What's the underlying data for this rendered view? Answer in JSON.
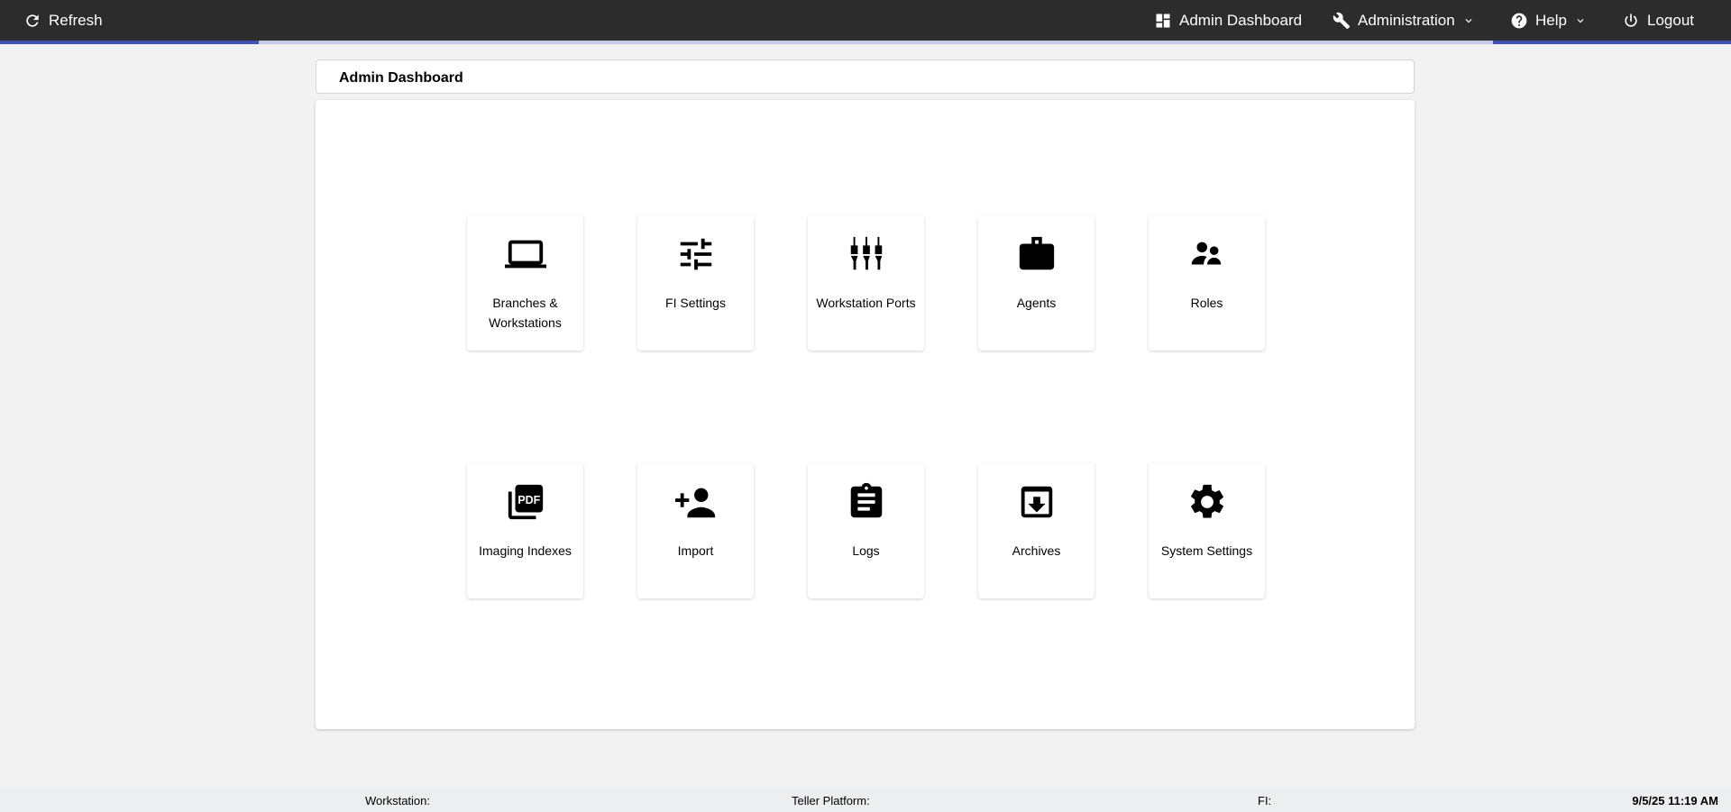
{
  "topbar": {
    "refresh": "Refresh",
    "admin_dashboard": "Admin Dashboard",
    "administration": "Administration",
    "help": "Help",
    "logout": "Logout"
  },
  "page_title": "Admin Dashboard",
  "tiles": [
    {
      "label": "Branches & Workstations",
      "icon": "laptop-icon"
    },
    {
      "label": "FI Settings",
      "icon": "sliders-icon"
    },
    {
      "label": "Workstation Ports",
      "icon": "ports-icon"
    },
    {
      "label": "Agents",
      "icon": "briefcase-icon"
    },
    {
      "label": "Roles",
      "icon": "people-icon"
    },
    {
      "label": "Imaging Indexes",
      "icon": "pdf-icon"
    },
    {
      "label": "Import",
      "icon": "person-add-icon"
    },
    {
      "label": "Logs",
      "icon": "clipboard-icon"
    },
    {
      "label": "Archives",
      "icon": "archive-icon"
    },
    {
      "label": "System Settings",
      "icon": "gear-icon"
    }
  ],
  "footer": {
    "workstation": "Workstation:",
    "teller_platform": "Teller Platform:",
    "fi": "FI:",
    "datetime": "9/5/25 11:19 AM"
  }
}
